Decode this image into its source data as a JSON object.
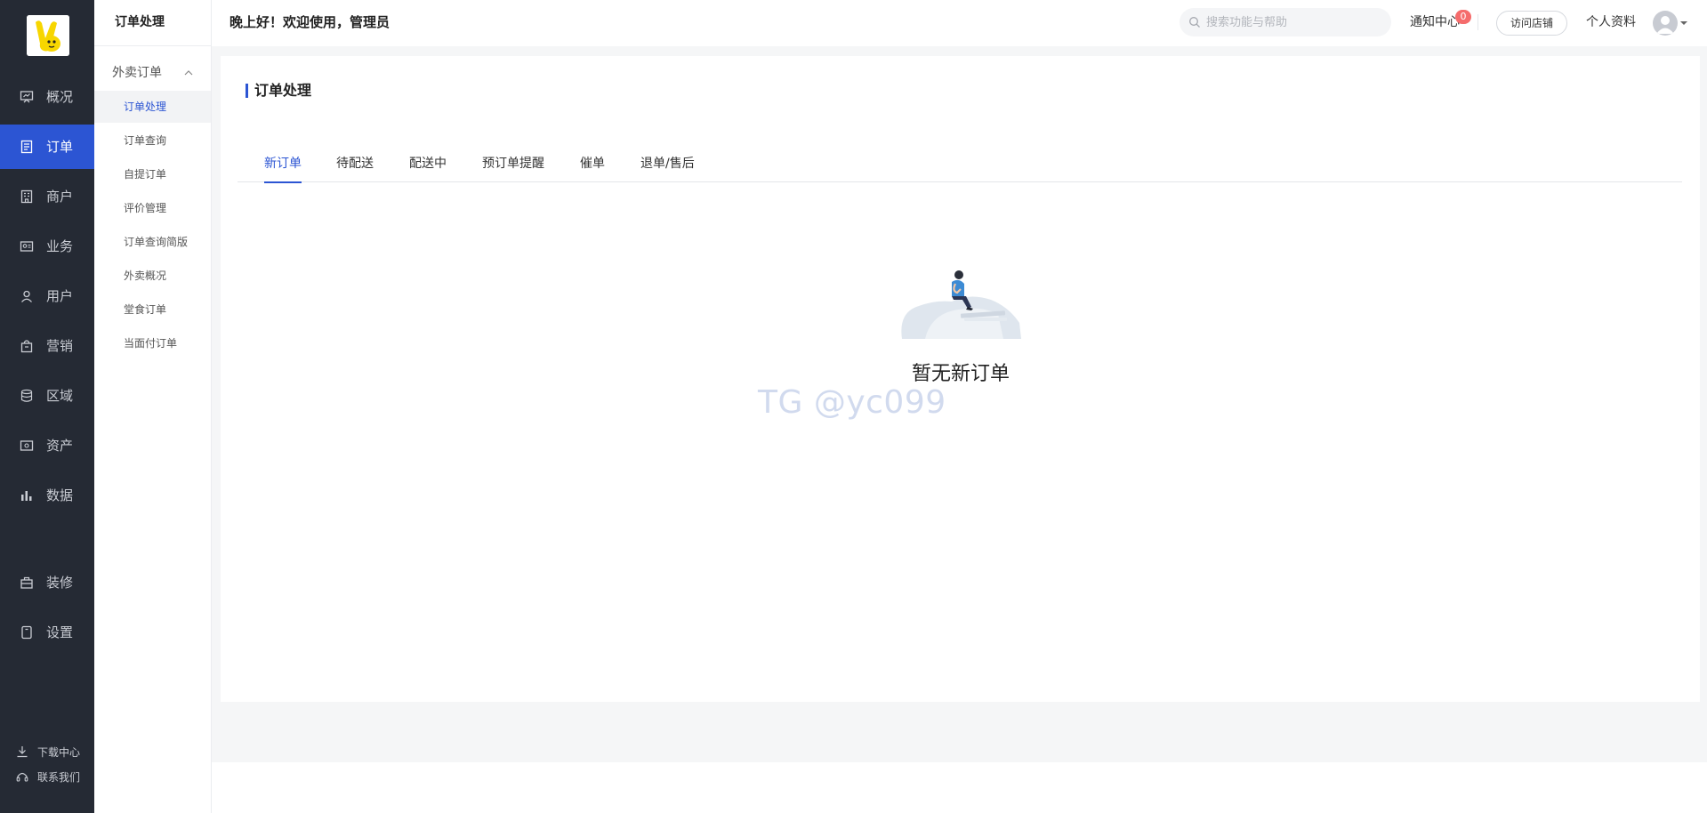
{
  "nav": {
    "items": [
      {
        "label": "概况",
        "icon": "presentation-icon"
      },
      {
        "label": "订单",
        "icon": "document-icon",
        "active": true
      },
      {
        "label": "商户",
        "icon": "building-icon"
      },
      {
        "label": "业务",
        "icon": "id-card-icon"
      },
      {
        "label": "用户",
        "icon": "user-icon"
      },
      {
        "label": "营销",
        "icon": "bag-icon"
      },
      {
        "label": "区域",
        "icon": "database-icon"
      },
      {
        "label": "资产",
        "icon": "wallet-icon"
      },
      {
        "label": "数据",
        "icon": "bar-chart-icon"
      },
      {
        "label": "装修",
        "icon": "briefcase-icon"
      },
      {
        "label": "设置",
        "icon": "device-icon"
      }
    ],
    "footer": [
      {
        "label": "下载中心",
        "icon": "download-icon"
      },
      {
        "label": "联系我们",
        "icon": "headset-icon"
      }
    ]
  },
  "subnav": {
    "title": "订单处理",
    "group": "外卖订单",
    "items": [
      {
        "label": "订单处理",
        "active": true
      },
      {
        "label": "订单查询"
      },
      {
        "label": "自提订单"
      },
      {
        "label": "评价管理"
      },
      {
        "label": "订单查询简版"
      },
      {
        "label": "外卖概况"
      },
      {
        "label": "堂食订单"
      },
      {
        "label": "当面付订单"
      }
    ]
  },
  "header": {
    "greeting": "晚上好！欢迎使用，管理员",
    "search_placeholder": "搜索功能与帮助",
    "notify_label": "通知中心",
    "notify_count": "0",
    "visit_store": "访问店铺",
    "profile": "个人资料"
  },
  "main": {
    "title": "订单处理",
    "tabs": [
      "新订单",
      "待配送",
      "配送中",
      "预订单提醒",
      "催单",
      "退单/售后"
    ],
    "active_tab": 0,
    "empty_text": "暂无新订单",
    "watermark": "TG @yc099"
  },
  "colors": {
    "nav_bg": "#252a34",
    "accent": "#2c55d3",
    "badge": "#f56c6c",
    "page_bg": "#f5f6f7"
  }
}
